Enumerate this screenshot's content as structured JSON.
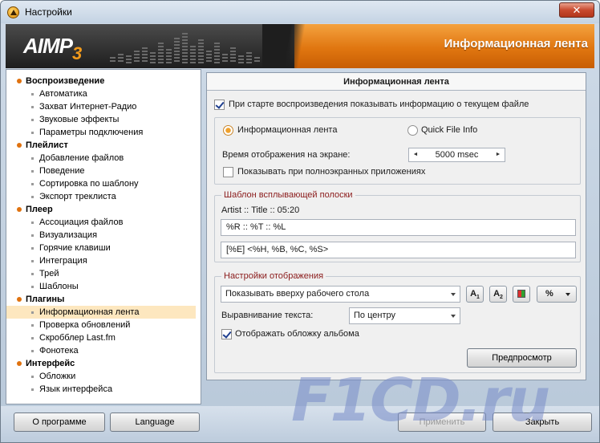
{
  "window": {
    "title": "Настройки",
    "close_label": "✕"
  },
  "banner": {
    "logo": "AIMP",
    "logo_version": "3",
    "section_title": "Информационная лента"
  },
  "tree": [
    {
      "label": "Воспроизведение",
      "level": 0
    },
    {
      "label": "Автоматика",
      "level": 1
    },
    {
      "label": "Захват Интернет-Радио",
      "level": 1
    },
    {
      "label": "Звуковые эффекты",
      "level": 1
    },
    {
      "label": "Параметры подключения",
      "level": 1
    },
    {
      "label": "Плейлист",
      "level": 0
    },
    {
      "label": "Добавление файлов",
      "level": 1
    },
    {
      "label": "Поведение",
      "level": 1
    },
    {
      "label": "Сортировка по шаблону",
      "level": 1
    },
    {
      "label": "Экспорт треклиста",
      "level": 1
    },
    {
      "label": "Плеер",
      "level": 0
    },
    {
      "label": "Ассоциация файлов",
      "level": 1
    },
    {
      "label": "Визуализация",
      "level": 1
    },
    {
      "label": "Горячие клавиши",
      "level": 1
    },
    {
      "label": "Интеграция",
      "level": 1
    },
    {
      "label": "Трей",
      "level": 1
    },
    {
      "label": "Шаблоны",
      "level": 1
    },
    {
      "label": "Плагины",
      "level": 0
    },
    {
      "label": "Информационная лента",
      "level": 1,
      "selected": true
    },
    {
      "label": "Проверка обновлений",
      "level": 1
    },
    {
      "label": "Скробблер Last.fm",
      "level": 1
    },
    {
      "label": "Фонотека",
      "level": 1
    },
    {
      "label": "Интерфейс",
      "level": 0
    },
    {
      "label": "Обложки",
      "level": 1
    },
    {
      "label": "Язык интерфейса",
      "level": 1
    }
  ],
  "panel": {
    "header": "Информационная лента",
    "show_on_start": {
      "label": "При старте воспроизведения показывать информацию о текущем файле",
      "checked": true
    },
    "mode": {
      "option1": {
        "label": "Информационная лента",
        "selected": true
      },
      "option2": {
        "label": "Quick File Info",
        "selected": false
      }
    },
    "display_time": {
      "label": "Время отображения на экране:",
      "value": "5000 msec",
      "left": "◄",
      "right": "►"
    },
    "fullscreen": {
      "label": "Показывать при полноэкранных приложениях",
      "checked": false
    },
    "template": {
      "title": "Шаблон всплывающей полоски",
      "preview": "Artist :: Title :: 05:20",
      "line1": "%R :: %T :: %L",
      "line2": "[%E] <%H, %B, %C, %S>"
    },
    "display": {
      "title": "Настройки отображения",
      "position_value": "Показывать вверху рабочего стола",
      "font1": "A",
      "font1_sub": "1",
      "font2": "A",
      "font2_sub": "2",
      "percent": "%",
      "align_label": "Выравнивание текста:",
      "align_value": "По центру",
      "show_cover": {
        "label": "Отображать обложку альбома",
        "checked": true
      },
      "preview_button": "Предпросмотр"
    }
  },
  "footer": {
    "about": "О программе",
    "language": "Language",
    "apply": "Применить",
    "close": "Закрыть"
  },
  "watermark": "F1CD.ru"
}
